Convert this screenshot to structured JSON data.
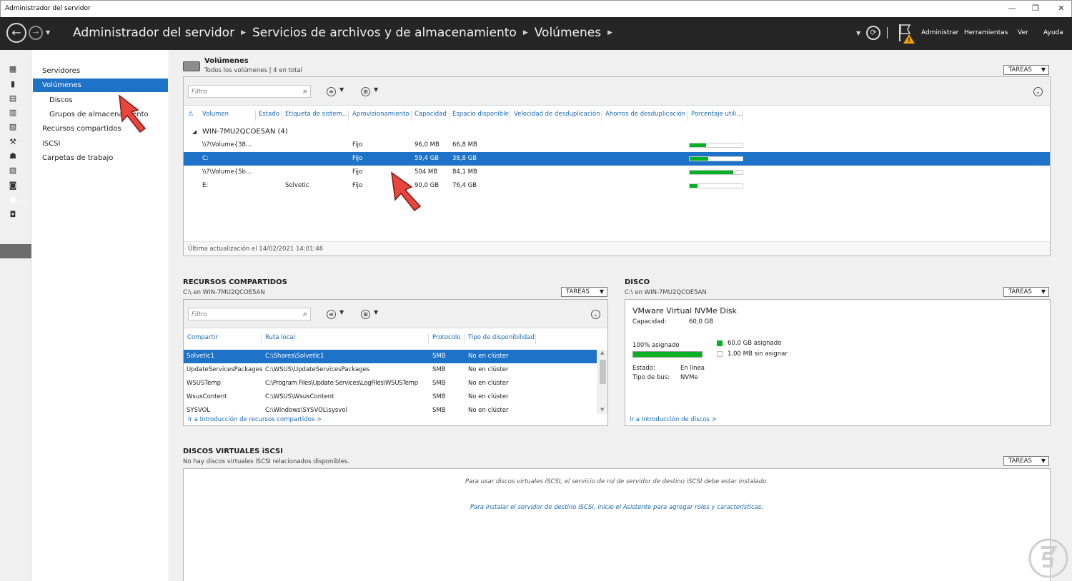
{
  "window": {
    "title": "Administrador del servidor",
    "controls": [
      "—",
      "❐",
      "✕"
    ]
  },
  "header": {
    "breadcrumb": [
      "Administrador del servidor",
      "Servicios de archivos y de almacenamiento",
      "Volúmenes"
    ],
    "menu": [
      "Administrar",
      "Herramientas",
      "Ver",
      "Ayuda"
    ]
  },
  "nav": {
    "items": [
      "Servidores",
      "Volúmenes",
      "Discos",
      "Grupos de almacenamiento",
      "Recursos compartidos",
      "iSCSI",
      "Carpetas de trabajo"
    ]
  },
  "volumes": {
    "title": "Volúmenes",
    "subtitle": "Todos los volúmenes | 4 en total",
    "tasks": "TAREAS",
    "filter_placeholder": "Filtro",
    "columns": [
      "Volumen",
      "Estado",
      "Etiqueta de sistem...",
      "Aprovisionamiento",
      "Capacidad",
      "Espacio disponible",
      "Velocidad de desduplicación",
      "Ahorros de desduplicación",
      "Porcentaje utili..."
    ],
    "group": "WIN-7MU2QCOE5AN (4)",
    "rows": [
      {
        "volume": "\\\\?\\Volume{38...",
        "label": "",
        "prov": "Fijo",
        "capacity": "96,0 MB",
        "free": "66,8 MB",
        "used_pct": 31
      },
      {
        "volume": "C:",
        "label": "",
        "prov": "Fijo",
        "capacity": "59,4 GB",
        "free": "38,8 GB",
        "used_pct": 35
      },
      {
        "volume": "\\\\?\\Volume{5b...",
        "label": "",
        "prov": "Fijo",
        "capacity": "504 MB",
        "free": "84,1 MB",
        "used_pct": 83
      },
      {
        "volume": "E:",
        "label": "Solvetic",
        "prov": "Fijo",
        "capacity": "90,0 GB",
        "free": "76,4 GB",
        "used_pct": 15
      }
    ],
    "last_update": "Última actualización el 14/02/2021 14:01:46"
  },
  "shares": {
    "title": "RECURSOS COMPARTIDOS",
    "subtitle": "C:\\ en WIN-7MU2QCOE5AN",
    "tasks": "TAREAS",
    "filter_placeholder": "Filtro",
    "columns": [
      "Compartir",
      "Ruta local",
      "Protocolo",
      "Tipo de disponibilidad"
    ],
    "rows": [
      {
        "name": "Solvetic1",
        "path": "C:\\Shares\\Solvetic1",
        "protocol": "SMB",
        "avail": "No en clúster"
      },
      {
        "name": "UpdateServicesPackages",
        "path": "C:\\WSUS\\UpdateServicesPackages",
        "protocol": "SMB",
        "avail": "No en clúster"
      },
      {
        "name": "WSUSTemp",
        "path": "C:\\Program Files\\Update Services\\LogFiles\\WSUSTemp",
        "protocol": "SMB",
        "avail": "No en clúster"
      },
      {
        "name": "WsusContent",
        "path": "C:\\WSUS\\WsusContent",
        "protocol": "SMB",
        "avail": "No en clúster"
      },
      {
        "name": "SYSVOL",
        "path": "C:\\Windows\\SYSVOL\\sysvol",
        "protocol": "SMB",
        "avail": "No en clúster"
      }
    ],
    "link": "Ir a Introducción de recursos compartidos >"
  },
  "disk": {
    "title": "DISCO",
    "subtitle": "C:\\ en WIN-7MU2QCOE5AN",
    "tasks": "TAREAS",
    "name": "VMware Virtual NVMe Disk",
    "capacity_label": "Capacidad:",
    "capacity": "60,0 GB",
    "allocated_label": "100% asignado",
    "allocated_pct": 100,
    "legend_allocated": "60,0 GB asignado",
    "legend_unallocated": "1,00 MB sin asignar",
    "state_label": "Estado:",
    "state": "En línea",
    "bus_label": "Tipo de bus:",
    "bus": "NVMe",
    "link": "Ir a Introducción de discos >"
  },
  "iscsi": {
    "title": "DISCOS VIRTUALES iSCSI",
    "subtitle": "No hay discos virtuales iSCSI relacionados disponibles.",
    "tasks": "TAREAS",
    "message": "Para usar discos virtuales iSCSI, el servicio de rol de servidor de destino iSCSI debe estar instalado.",
    "install_link": "Para instalar el servidor de destino iSCSI, inicie el Asistente para agregar roles y características."
  },
  "colors": {
    "accent": "#1e73c9",
    "bar_fill": "#06b025",
    "header_bg": "#252525",
    "link": "#1a68b0"
  }
}
